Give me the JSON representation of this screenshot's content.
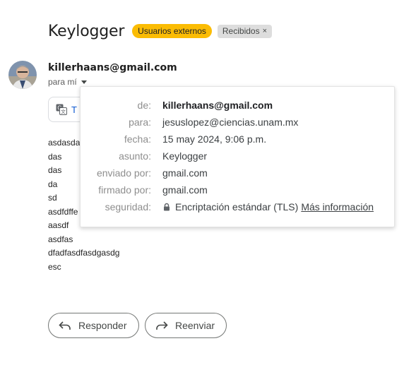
{
  "email": {
    "subject": "Keylogger",
    "labels": {
      "external": "Usuarios externos",
      "inbox": "Recibidos",
      "inbox_remove": "×"
    },
    "sender": "killerhaans@gmail.com",
    "recipients_summary": "para mí",
    "translate_label": "T",
    "body_lines": [
      "asdasda",
      "das",
      "das",
      "da",
      "sd",
      "asdfdffe",
      "aasdf",
      "asdfas",
      "dfadfasdfasdgasdg",
      "esc"
    ]
  },
  "details_popup": {
    "rows": [
      {
        "key": "de:",
        "value": "killerhaans@gmail.com"
      },
      {
        "key": "para:",
        "value": "jesuslopez@ciencias.unam.mx"
      },
      {
        "key": "fecha:",
        "value": "15 may 2024, 9:06 p.m."
      },
      {
        "key": "asunto:",
        "value": "Keylogger"
      },
      {
        "key": "enviado por:",
        "value": "gmail.com"
      },
      {
        "key": "firmado por:",
        "value": "gmail.com"
      },
      {
        "key": "seguridad:",
        "value": "Encriptación estándar (TLS)",
        "link": "Más información"
      }
    ]
  },
  "actions": {
    "reply": "Responder",
    "forward": "Reenviar"
  },
  "colors": {
    "external_label": "#fbbc04",
    "inbox_label": "#dddddd",
    "link_blue": "#0b57d0"
  },
  "icons": [
    "person-avatar",
    "translate-icon",
    "lock-icon",
    "reply-arrow-icon",
    "forward-arrow-icon",
    "caret-down-icon"
  ]
}
